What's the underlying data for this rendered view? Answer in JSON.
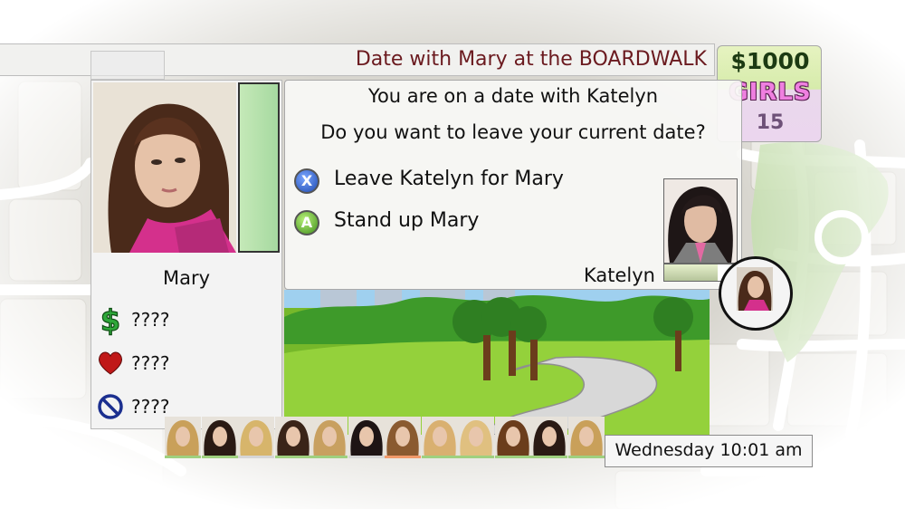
{
  "header": {
    "title": "Date with Mary at the BOARDWALK"
  },
  "stats": {
    "money": "$1000",
    "girls_label": "GIRLS",
    "girls_count": "15"
  },
  "girl_panel": {
    "name": "Mary",
    "affection_level": 1.0,
    "stats": [
      {
        "icon": "dollar-sign-icon",
        "value": "????"
      },
      {
        "icon": "heart-icon",
        "value": "????"
      },
      {
        "icon": "prohibited-icon",
        "value": "????"
      }
    ]
  },
  "dialog": {
    "line1": "You are on a date with Katelyn",
    "line2": "Do you want to leave your current date?",
    "options": [
      {
        "button": "X",
        "label": "Leave Katelyn for Mary",
        "color": "#3b6fd1"
      },
      {
        "button": "A",
        "label": "Stand up Mary",
        "color": "#5aa92e"
      }
    ],
    "current_date_name": "Katelyn",
    "current_date_meter": 0.75
  },
  "footer": {
    "time": "Wednesday 10:01 am"
  },
  "colors": {
    "title_text": "#6b1a1f",
    "money": "#1c3a12",
    "girls": "#ef7fe0",
    "affection": "#a6d9a0"
  }
}
